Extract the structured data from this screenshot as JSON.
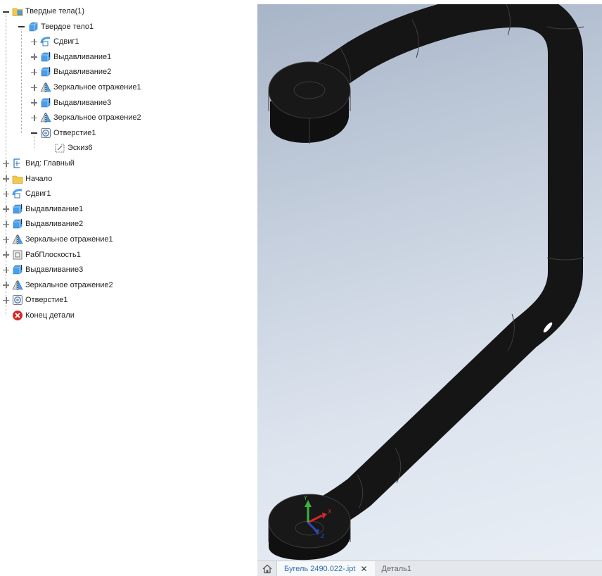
{
  "browser": {
    "items": [
      {
        "label": "Твердые тела(1)",
        "icon": "solid-bodies-folder-icon",
        "level": 0,
        "expander": "minus"
      },
      {
        "label": "Твердое тело1",
        "icon": "solid-body-icon",
        "level": 1,
        "expander": "minus"
      },
      {
        "label": "Сдвиг1",
        "icon": "sweep-icon",
        "level": 2,
        "expander": "plus"
      },
      {
        "label": "Выдавливание1",
        "icon": "extrude-icon",
        "level": 2,
        "expander": "plus"
      },
      {
        "label": "Выдавливание2",
        "icon": "extrude-icon",
        "level": 2,
        "expander": "plus"
      },
      {
        "label": "Зеркальное отражение1",
        "icon": "mirror-icon",
        "level": 2,
        "expander": "plus"
      },
      {
        "label": "Выдавливание3",
        "icon": "extrude-icon",
        "level": 2,
        "expander": "plus"
      },
      {
        "label": "Зеркальное отражение2",
        "icon": "mirror-icon",
        "level": 2,
        "expander": "plus"
      },
      {
        "label": "Отверстие1",
        "icon": "hole-icon",
        "level": 2,
        "expander": "minus"
      },
      {
        "label": "Эскиз6",
        "icon": "sketch-icon",
        "level": 3,
        "expander": "none"
      },
      {
        "label": "Вид: Главный",
        "icon": "view-rep-icon",
        "level": 0,
        "expander": "plus"
      },
      {
        "label": "Начало",
        "icon": "origin-folder-icon",
        "level": 0,
        "expander": "plus"
      },
      {
        "label": "Сдвиг1",
        "icon": "sweep-icon",
        "level": 0,
        "expander": "plus"
      },
      {
        "label": "Выдавливание1",
        "icon": "extrude-icon",
        "level": 0,
        "expander": "plus"
      },
      {
        "label": "Выдавливание2",
        "icon": "extrude-icon",
        "level": 0,
        "expander": "plus"
      },
      {
        "label": "Зеркальное отражение1",
        "icon": "mirror-icon",
        "level": 0,
        "expander": "plus"
      },
      {
        "label": "РабПлоскость1",
        "icon": "work-plane-icon",
        "level": 0,
        "expander": "plus"
      },
      {
        "label": "Выдавливание3",
        "icon": "extrude-icon",
        "level": 0,
        "expander": "plus"
      },
      {
        "label": "Зеркальное отражение2",
        "icon": "mirror-icon",
        "level": 0,
        "expander": "plus"
      },
      {
        "label": "Отверстие1",
        "icon": "hole-icon",
        "level": 0,
        "expander": "plus"
      },
      {
        "label": "Конец детали",
        "icon": "end-of-part-icon",
        "level": 0,
        "expander": "none"
      }
    ]
  },
  "viewport": {
    "triad": {
      "x_label": "X",
      "y_label": "Y",
      "z_label": "Z"
    },
    "colors": {
      "body": "#151515",
      "edge": "#3c3c3c",
      "x_axis": "#d2292a",
      "y_axis": "#3cb43c",
      "z_axis": "#2c49b8"
    }
  },
  "tabs": {
    "home_icon": "home-icon",
    "active_label": "Бугель 2490.022-.ipt",
    "close_glyph": "✕",
    "inactive_label": "Деталь1"
  }
}
